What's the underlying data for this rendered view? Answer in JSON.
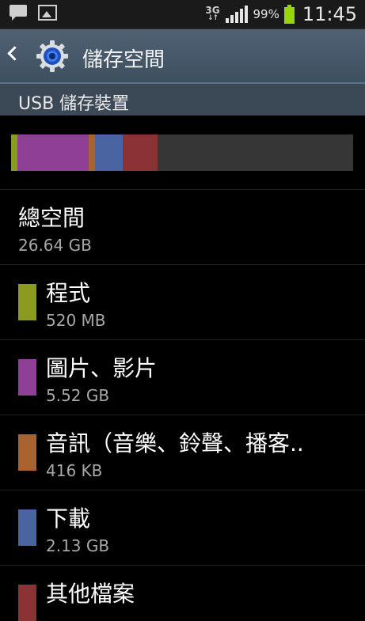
{
  "status_bar": {
    "network": "3G",
    "battery_percent": "99%",
    "battery_level": 0.99,
    "time": "11:45",
    "icons": [
      "chat-icon",
      "image-icon",
      "signal-icon",
      "battery-icon"
    ]
  },
  "action_bar": {
    "title": "儲存空間",
    "icons": [
      "back-icon",
      "settings-gear-icon"
    ]
  },
  "section": {
    "title": "USB 儲存裝置"
  },
  "colors": {
    "apps": "#8c9a1f",
    "media": "#8f3f96",
    "audio": "#a9632e",
    "downloads": "#4a64a2",
    "other": "#8a3234",
    "free": "#363636"
  },
  "storage_bar_segments": [
    {
      "name": "apps",
      "size_gb": 0.52
    },
    {
      "name": "media",
      "size_gb": 5.52
    },
    {
      "name": "audio",
      "size_gb": 0.416
    },
    {
      "name": "downloads",
      "size_gb": 2.13
    },
    {
      "name": "other",
      "size_gb": 2.7
    }
  ],
  "total": {
    "label": "總空間",
    "value": "26.64 GB"
  },
  "items": [
    {
      "label": "程式",
      "value": "520 MB"
    },
    {
      "label": "圖片、影片",
      "value": "5.52 GB"
    },
    {
      "label": "音訊（音樂、鈴聲、播客..",
      "value": "416 KB"
    },
    {
      "label": "下載",
      "value": "2.13 GB"
    },
    {
      "label": "其他檔案",
      "value": ""
    }
  ]
}
